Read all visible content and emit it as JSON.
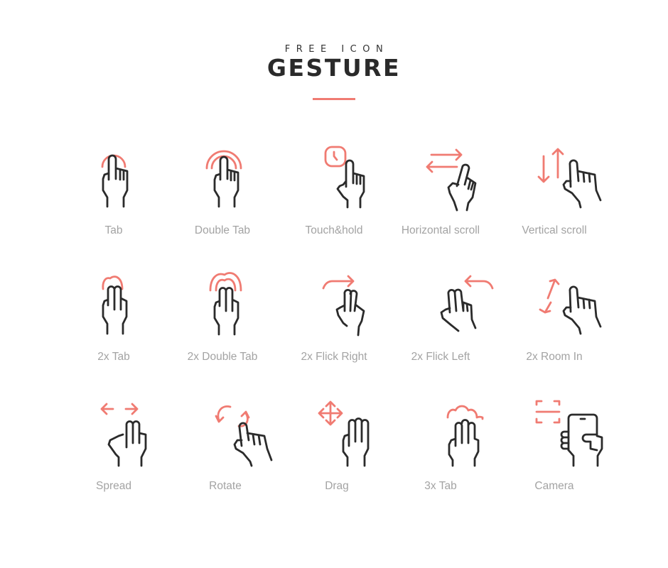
{
  "header": {
    "subtitle": "FREE ICON",
    "title": "GESTURE"
  },
  "colors": {
    "accent": "#f07b72",
    "stroke": "#2b2b2b",
    "label": "#a3a3a3"
  },
  "icons": [
    {
      "label": "Tab",
      "icon": "tap-icon"
    },
    {
      "label": "Double Tab",
      "icon": "double-tap-icon"
    },
    {
      "label": "Touch&hold",
      "icon": "touch-hold-icon"
    },
    {
      "label": "Horizontal scroll",
      "icon": "horizontal-scroll-icon"
    },
    {
      "label": "Vertical scroll",
      "icon": "vertical-scroll-icon"
    },
    {
      "label": "2x Tab",
      "icon": "two-finger-tap-icon"
    },
    {
      "label": "2x Double Tab",
      "icon": "two-finger-double-tap-icon"
    },
    {
      "label": "2x Flick Right",
      "icon": "two-finger-flick-right-icon"
    },
    {
      "label": "2x Flick Left",
      "icon": "two-finger-flick-left-icon"
    },
    {
      "label": "2x Room In",
      "icon": "two-finger-zoom-in-icon"
    },
    {
      "label": "Spread",
      "icon": "spread-icon"
    },
    {
      "label": "Rotate",
      "icon": "rotate-icon"
    },
    {
      "label": "Drag",
      "icon": "drag-icon"
    },
    {
      "label": "3x Tab",
      "icon": "three-finger-tap-icon"
    },
    {
      "label": "Camera",
      "icon": "camera-icon"
    }
  ]
}
